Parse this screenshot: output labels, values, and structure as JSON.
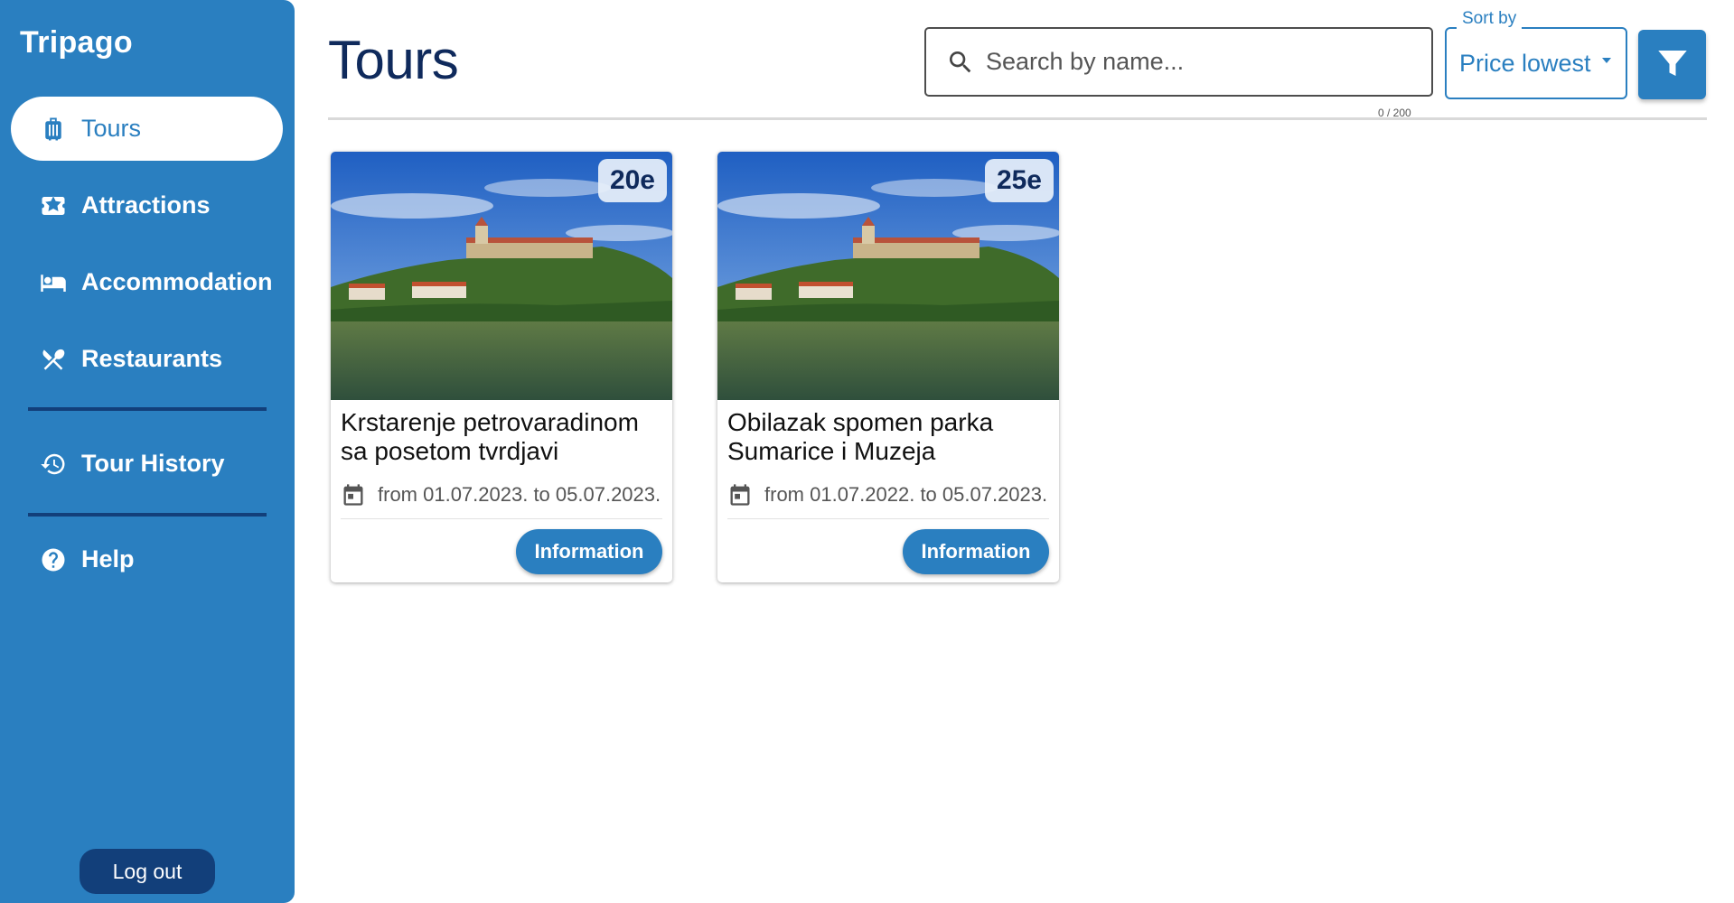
{
  "app": {
    "name": "Tripago"
  },
  "sidebar": {
    "items": [
      {
        "label": "Tours",
        "icon": "luggage-icon",
        "active": true
      },
      {
        "label": "Attractions",
        "icon": "ticket-star-icon",
        "active": false
      },
      {
        "label": "Accommodation",
        "icon": "bed-icon",
        "active": false
      },
      {
        "label": "Restaurants",
        "icon": "utensils-icon",
        "active": false
      },
      {
        "label": "Tour History",
        "icon": "history-icon",
        "active": false
      },
      {
        "label": "Help",
        "icon": "help-icon",
        "active": false
      }
    ],
    "logout_label": "Log out"
  },
  "header": {
    "title": "Tours",
    "search": {
      "placeholder": "Search by name...",
      "value": "",
      "counter": "0 / 200"
    },
    "sort": {
      "label": "Sort by",
      "value": "Price lowest"
    },
    "filter_icon": "filter-icon"
  },
  "tours": [
    {
      "title": "Krstarenje petrovaradinom sa posetom tvrdjavi",
      "price": "20e",
      "dates": "from 01.07.2023. to 05.07.2023.",
      "button": "Information"
    },
    {
      "title": "Obilazak spomen parka Sumarice i Muzeja",
      "price": "25e",
      "dates": "from 01.07.2022. to 05.07.2023.",
      "button": "Information"
    }
  ],
  "colors": {
    "primary": "#2a7fc0",
    "dark": "#123f7a",
    "title": "#0f2a5c"
  }
}
